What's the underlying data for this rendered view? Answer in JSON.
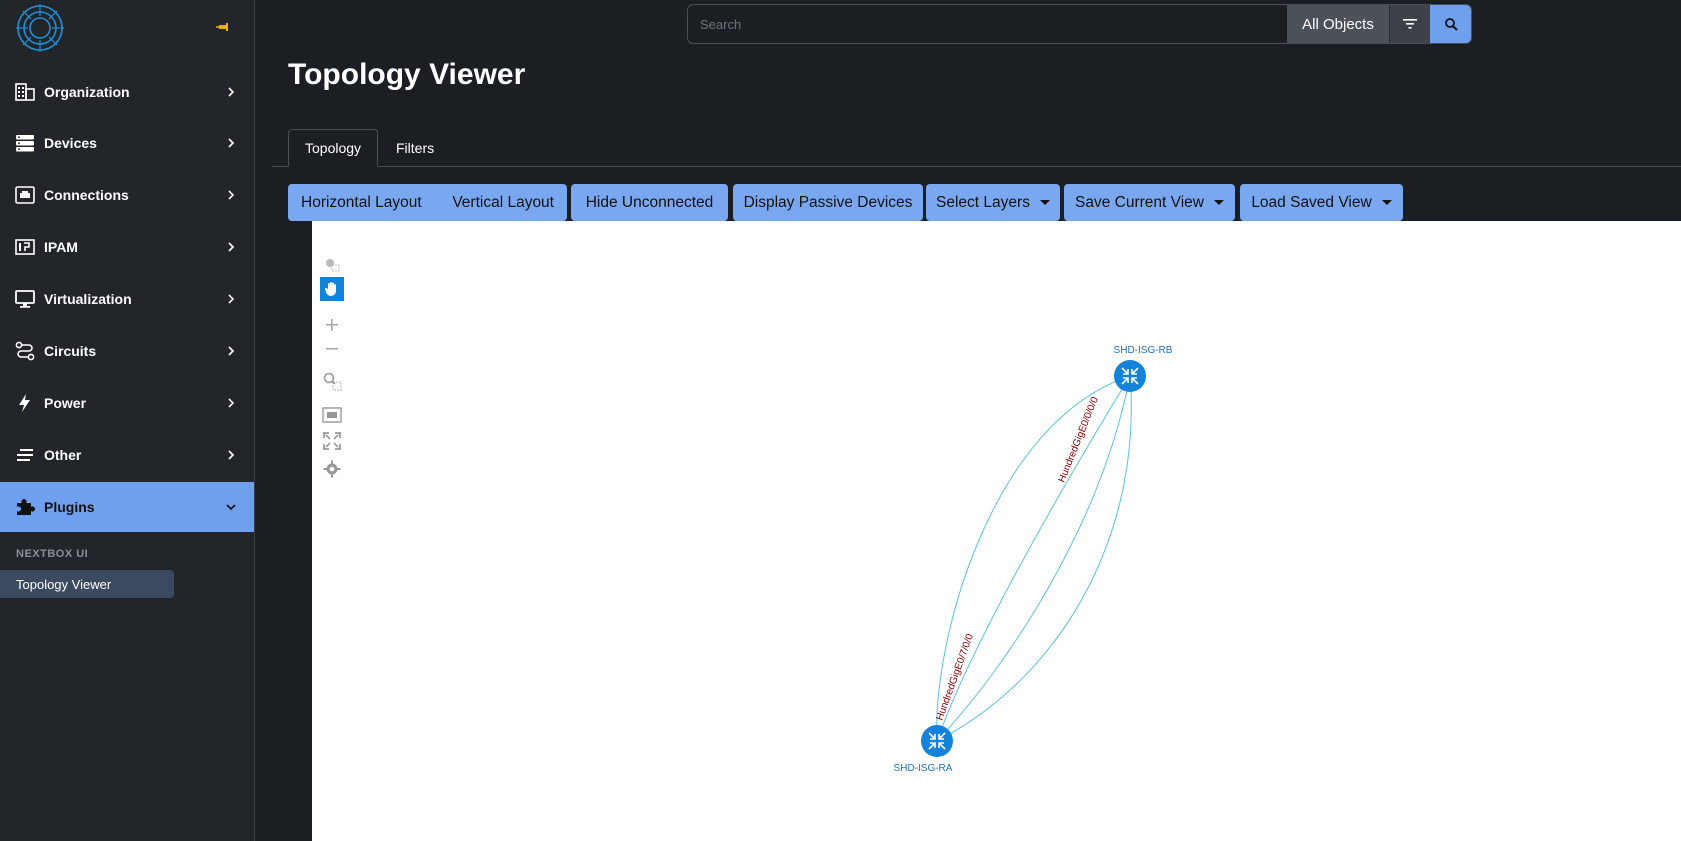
{
  "sidebar": {
    "items": [
      {
        "label": "Organization",
        "icon": "building-icon"
      },
      {
        "label": "Devices",
        "icon": "server-icon"
      },
      {
        "label": "Connections",
        "icon": "ethernet-icon"
      },
      {
        "label": "IPAM",
        "icon": "ip-icon"
      },
      {
        "label": "Virtualization",
        "icon": "monitor-icon"
      },
      {
        "label": "Circuits",
        "icon": "circuit-icon"
      },
      {
        "label": "Power",
        "icon": "lightning-icon"
      },
      {
        "label": "Other",
        "icon": "lines-icon"
      },
      {
        "label": "Plugins",
        "icon": "puzzle-icon"
      }
    ],
    "section_header": "NEXTBOX UI",
    "sub_item": "Topology Viewer"
  },
  "search": {
    "placeholder": "Search",
    "scope": "All Objects"
  },
  "page": {
    "title": "Topology Viewer"
  },
  "tabs": [
    "Topology",
    "Filters"
  ],
  "toolbar": {
    "horizontal": "Horizontal Layout",
    "vertical": "Vertical Layout",
    "hide_unconnected": "Hide Unconnected",
    "display_passive": "Display Passive Devices",
    "select_layers": "Select Layers",
    "save_view": "Save Current View",
    "load_view": "Load Saved View"
  },
  "topology": {
    "nodes": [
      {
        "name": "SHD-ISG-RB"
      },
      {
        "name": "SHD-ISG-RA"
      }
    ],
    "link_labels": [
      "HundredGigE0/0/0/0",
      "HundredGigE0/7/0/0"
    ]
  },
  "colors": {
    "accent": "#6ea0ee",
    "node": "#1283d9",
    "link": "#5bc3dd",
    "link_label": "#8b0000"
  }
}
